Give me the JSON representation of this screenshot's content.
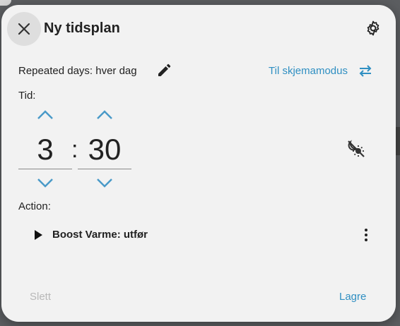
{
  "dialog": {
    "title": "Ny tidsplan"
  },
  "schedule": {
    "repeated_days": "Repeated days: hver dag",
    "mode_link": "Til skjemamodus",
    "time_label": "Tid:",
    "hours": "3",
    "minutes": "30",
    "separator": ":",
    "action_label": "Action:",
    "action_text": "Boost Varme: utfør"
  },
  "footer": {
    "delete_label": "Slett",
    "save_label": "Lagre"
  },
  "colors": {
    "accent": "#2f8fc2",
    "arrow": "#4a9ac8",
    "disabled": "#b8b8b8",
    "dialog_bg": "#f2f2f2"
  },
  "icons": {
    "close": "close-icon",
    "settings": "gear-icon",
    "edit": "pencil-icon",
    "swap": "swap-horizontal-icon",
    "sun_off": "sun-moon-off-icon",
    "play": "play-icon",
    "more": "dots-vertical-icon"
  }
}
